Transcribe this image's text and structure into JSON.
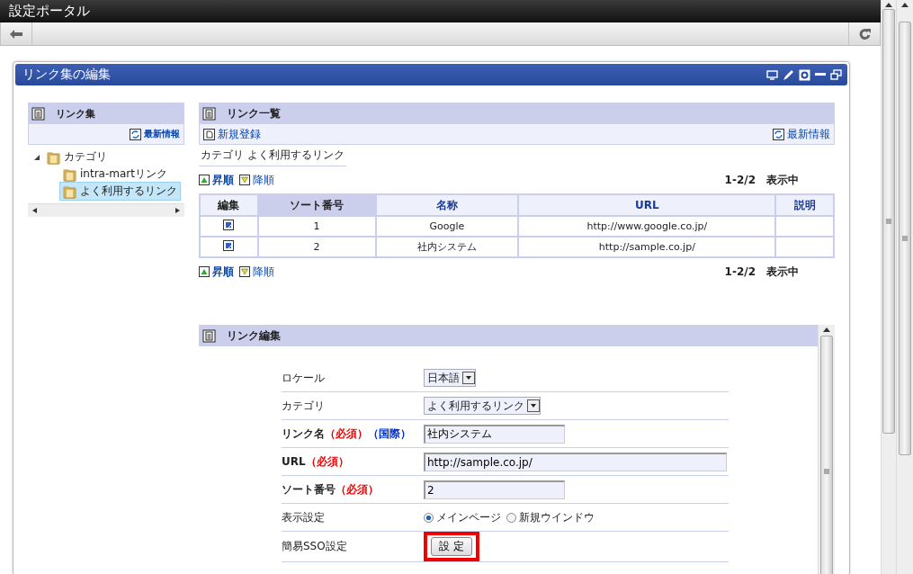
{
  "window": {
    "title": "設定ポータル"
  },
  "portlet": {
    "title": "リンク集の編集"
  },
  "tree_panel": {
    "title": "リンク集",
    "refresh_link": "最新情報",
    "tree": [
      {
        "label": "カテゴリ",
        "expanded": true,
        "selected": false,
        "children": [
          {
            "label": "intra-martリンク",
            "selected": false
          },
          {
            "label": "よく利用するリンク",
            "selected": true
          }
        ]
      }
    ]
  },
  "list_panel": {
    "title": "リンク一覧",
    "new_link": "新規登録",
    "refresh_link": "最新情報",
    "category_label": "カテゴリ",
    "category_value": "よく利用するリンク",
    "sort_bars": [
      {
        "sort_asc": "昇順",
        "sort_desc": "降順",
        "count": "1-2/2",
        "count_suffix": "表示中"
      },
      {
        "sort_asc": "昇順",
        "sort_desc": "降順",
        "count": "1-2/2",
        "count_suffix": "表示中"
      }
    ],
    "columns": [
      {
        "label": "編集",
        "kind": "plain",
        "selected": false
      },
      {
        "label": "ソート番号",
        "kind": "link",
        "selected": true
      },
      {
        "label": "名称",
        "kind": "link",
        "selected": false
      },
      {
        "label": "URL",
        "kind": "link",
        "selected": false
      },
      {
        "label": "説明",
        "kind": "link",
        "selected": false
      }
    ],
    "rows": [
      {
        "sort_no": "1",
        "name": "Google",
        "url": "http://www.google.co.jp/"
      },
      {
        "sort_no": "2",
        "name": "社内システム",
        "url": "http://sample.co.jp/"
      }
    ]
  },
  "edit_panel": {
    "title": "リンク編集",
    "fields": [
      {
        "kind": "select",
        "label": "ロケール",
        "value": "日本語"
      },
      {
        "kind": "select",
        "label": "カテゴリ",
        "value": "よく利用するリンク"
      },
      {
        "kind": "text",
        "label": "リンク名",
        "required": "（必須）",
        "intl": "（国際）",
        "value": "社内システム"
      },
      {
        "kind": "url",
        "label": "URL",
        "required": "（必須）",
        "value": "http://sample.co.jp/"
      },
      {
        "kind": "text",
        "label": "ソート番号",
        "required": "（必須）",
        "value": "2"
      },
      {
        "kind": "radio",
        "label": "表示設定",
        "options": [
          {
            "label": "メインページ",
            "selected": true
          },
          {
            "label": "新規ウインドウ",
            "selected": false
          }
        ]
      },
      {
        "kind": "button",
        "label": "簡易SSO設定",
        "button": "設 定",
        "highlighted": true
      }
    ]
  }
}
